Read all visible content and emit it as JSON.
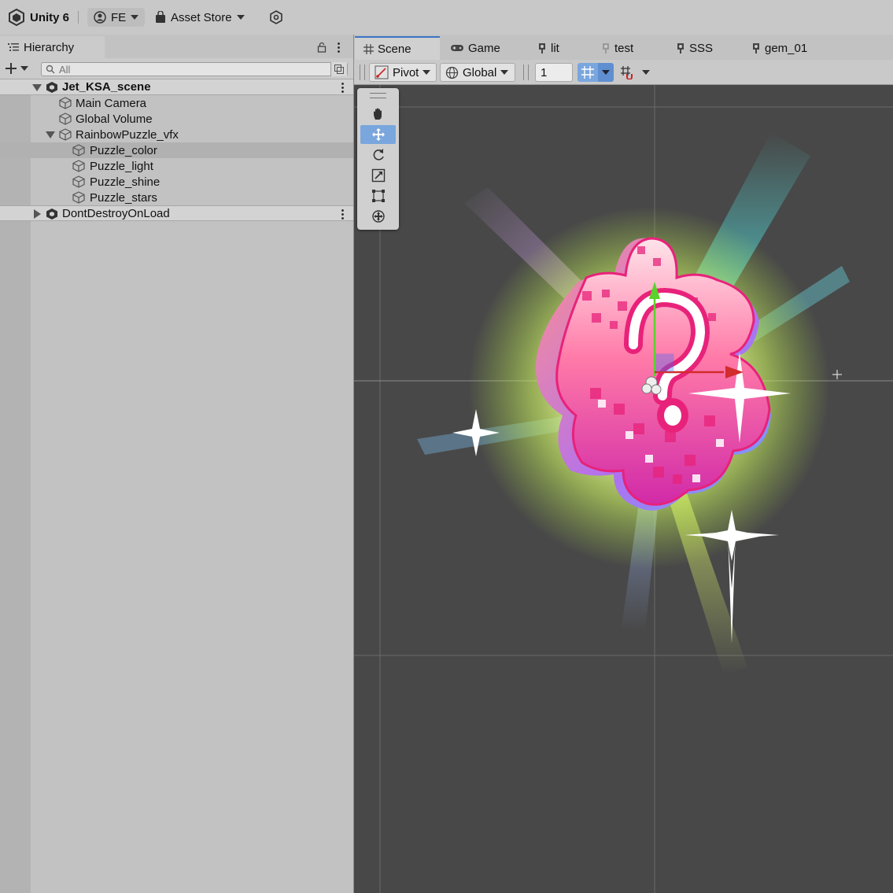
{
  "topbar": {
    "app_title": "Unity 6",
    "account": "FE",
    "asset_store": "Asset Store"
  },
  "hierarchy": {
    "tab_label": "Hierarchy",
    "search_placeholder": "All",
    "rows": [
      {
        "label": "Jet_KSA_scene"
      },
      {
        "label": "Main Camera"
      },
      {
        "label": "Global Volume"
      },
      {
        "label": "RainbowPuzzle_vfx"
      },
      {
        "label": "Puzzle_color"
      },
      {
        "label": "Puzzle_light"
      },
      {
        "label": "Puzzle_shine"
      },
      {
        "label": "Puzzle_stars"
      },
      {
        "label": "DontDestroyOnLoad"
      }
    ]
  },
  "scene_tabs": [
    {
      "label": "Scene"
    },
    {
      "label": "Game"
    },
    {
      "label": "lit"
    },
    {
      "label": "test"
    },
    {
      "label": "SSS"
    },
    {
      "label": "gem_01"
    }
  ],
  "scene_toolbar": {
    "pivot": "Pivot",
    "global": "Global",
    "grid_size": "1"
  },
  "colors": {
    "accent": "#3b74c6",
    "active_tool": "#7aa6de",
    "viewport_bg": "#484848",
    "puzzle_pink": "#e8227a"
  },
  "icons": [
    "unity-logo-icon",
    "account-icon",
    "asset-store-bag-icon",
    "settings-cog-icon",
    "hierarchy-list-icon",
    "lock-icon",
    "kebab-menu-icon",
    "add-icon",
    "search-icon",
    "scene-root-icon",
    "gameobject-cube-icon",
    "scene-grid-icon",
    "gamepad-icon",
    "pivot-icon",
    "globe-icon",
    "snap-grid-icon",
    "hand-tool-icon",
    "move-tool-icon",
    "rotate-tool-icon",
    "scale-tool-icon",
    "rect-tool-icon",
    "transform-tool-icon"
  ]
}
